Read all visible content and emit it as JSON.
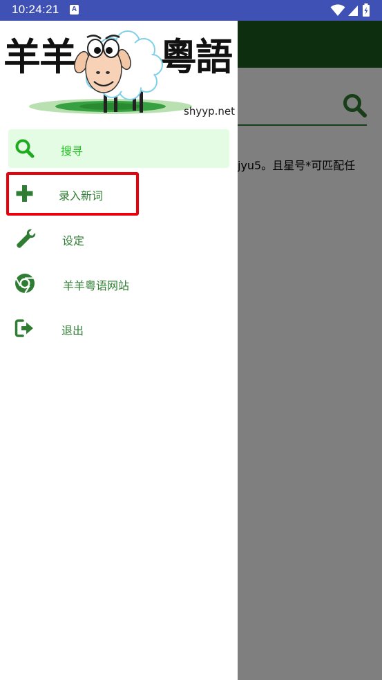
{
  "status_bar": {
    "time": "10:24:21",
    "notification_icon": "A",
    "icons": [
      "wifi-icon",
      "signal-icon",
      "battery-icon"
    ],
    "color": "#3f51b5"
  },
  "background": {
    "hint_text": "jyu5。且星号*可匹配任",
    "toolbar_color": "#1b5e20"
  },
  "drawer": {
    "brand_left": "羊羊",
    "brand_right": "粵語",
    "site_url": "shyyp.net",
    "items": [
      {
        "label": "搜寻",
        "icon": "search-icon",
        "active": true
      },
      {
        "label": "录入新词",
        "icon": "plus-icon",
        "active": false,
        "highlighted": true
      },
      {
        "label": "设定",
        "icon": "wrench-icon",
        "active": false
      },
      {
        "label": "羊羊粤语网站",
        "icon": "chrome-icon",
        "active": false
      },
      {
        "label": "退出",
        "icon": "exit-icon",
        "active": false
      }
    ],
    "accent_color": "#2e7d32",
    "active_color": "#20c020",
    "highlight_color": "#e8000b"
  }
}
